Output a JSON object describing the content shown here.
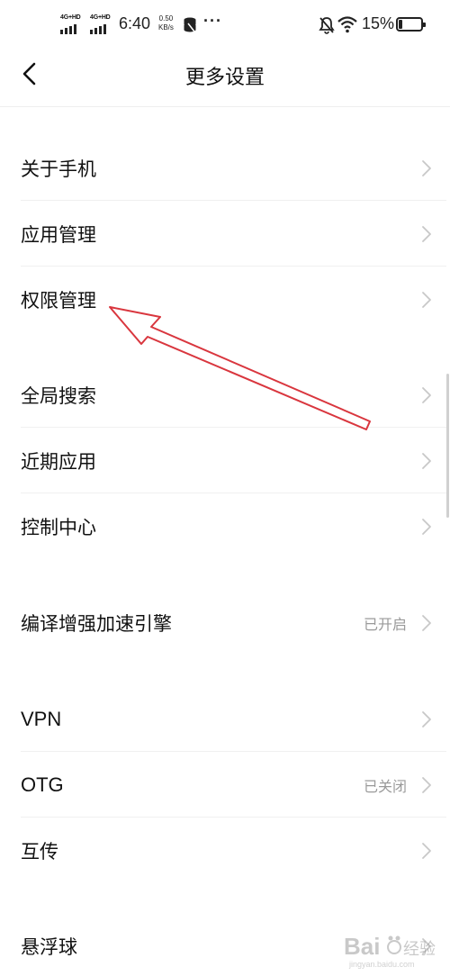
{
  "status_bar": {
    "net1": "4G+HD",
    "net2": "4G+HD",
    "time": "6:40",
    "speed_value": "0.50",
    "speed_unit": "KB/s",
    "more": "···",
    "battery": "15%",
    "battery_level": 0.15
  },
  "header": {
    "title": "更多设置"
  },
  "items": [
    {
      "label": "关于手机",
      "value": ""
    },
    {
      "label": "应用管理",
      "value": ""
    },
    {
      "label": "权限管理",
      "value": ""
    },
    {
      "label": "全局搜索",
      "value": ""
    },
    {
      "label": "近期应用",
      "value": ""
    },
    {
      "label": "控制中心",
      "value": ""
    },
    {
      "label": "编译增强加速引擎",
      "value": "已开启"
    },
    {
      "label": "VPN",
      "value": ""
    },
    {
      "label": "OTG",
      "value": "已关闭"
    },
    {
      "label": "互传",
      "value": ""
    },
    {
      "label": "悬浮球",
      "value": ""
    }
  ],
  "watermark": {
    "brand": "Bai",
    "suffix": "经验",
    "url": "jingyan.baidu.com"
  },
  "colors": {
    "annotation_arrow": "#d9363e",
    "chevron": "#c8c8c8",
    "secondary_text": "#9a9a9a"
  }
}
